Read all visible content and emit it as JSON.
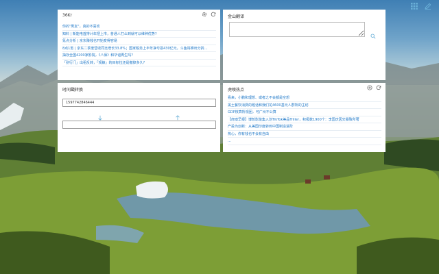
{
  "colors": {
    "link": "#1f78c8",
    "icon": "#6ab0d8",
    "title": "#333333"
  },
  "panels": {
    "news36kr": {
      "title": "36Kr",
      "icons": [
        "gear-icon",
        "refresh-icon"
      ],
      "items": [
        "你的\"男友\"，真的不喜欢",
        "知料 | 新能电首排计年把上市，普通人打么到就可以维种优势?",
        "氪点分析 | 京东赚钱也开始变得容易",
        "8点1氪 | 京东二季度营收同比增长33.8%；国家税务上半年净亏损430亿元，斗鱼将推出分拆…",
        "抽存全国4200家影院，《八佰》和华谊再生吗?",
        "「别行门」出租反转，「观鲸」的目标拉还是撤掉多久?"
      ]
    },
    "translate": {
      "title": "金山翻译",
      "input_value": "",
      "search_icon": "search-icon"
    },
    "timestamp": {
      "title": "时间戳转换",
      "input_value": "1597742846444",
      "output_value": "",
      "down_icon": "arrow-down-icon",
      "up_icon": "arrow-up-icon"
    },
    "huxiu": {
      "title": "虎嗅热点",
      "icons": [
        "add-circle-icon",
        "refresh-icon"
      ],
      "items": [
        "看来，小鹏和理想、或者之不会都是空想",
        "黑土餐饮消费的题话和我们花4600基元人群所的主纺",
        "GDP核算所观团，可广州不公算",
        "【虎嗅早报】博暂影能集入划TikTok美品Triller，积极数1900个：李国庆因交暴致所著",
        "产投为创新：从美国印度转到中国制造进阶",
        "热心，你有钱也不会有自由",
        "..."
      ]
    }
  }
}
